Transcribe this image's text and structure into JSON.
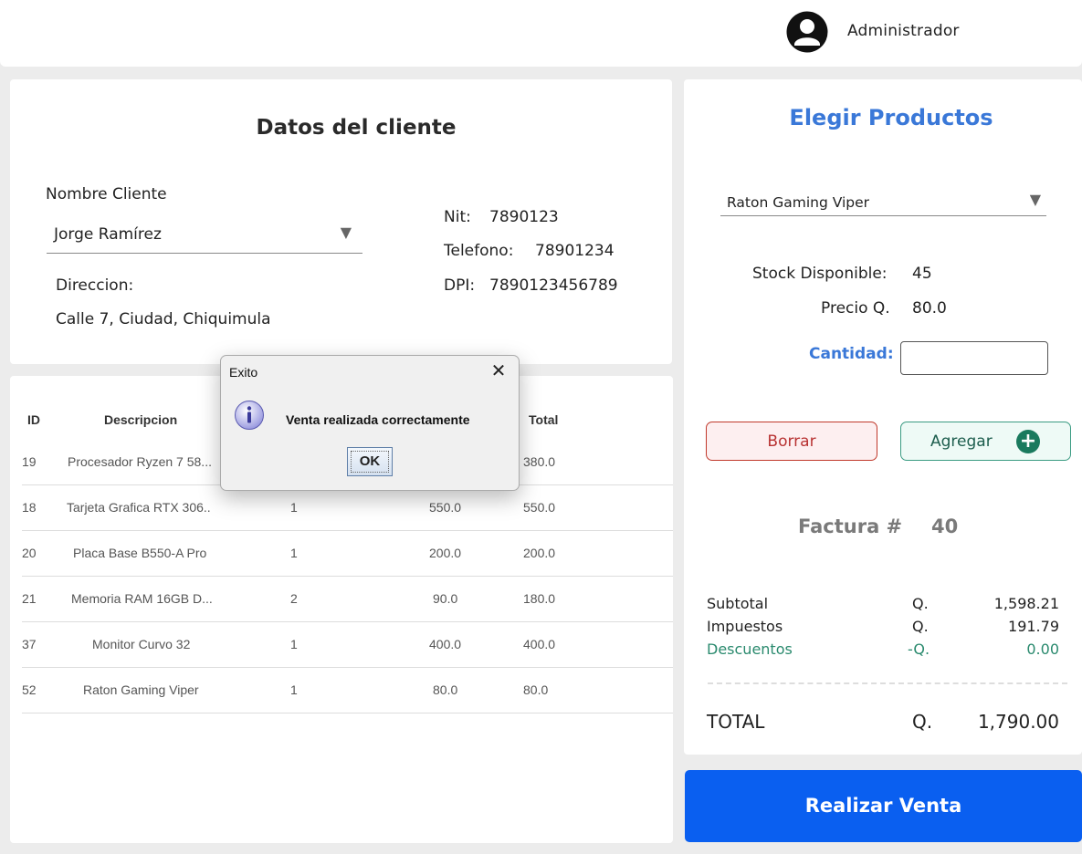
{
  "header": {
    "user_name": "Administrador",
    "avatar_icon": "user-circle-icon"
  },
  "client": {
    "title": "Datos del cliente",
    "name_label": "Nombre Cliente",
    "name_value": "Jorge Ramírez",
    "address_label": "Direccion:",
    "address_value": "Calle 7, Ciudad, Chiquimula",
    "nit_label": "Nit:",
    "nit_value": "7890123",
    "phone_label": "Telefono:",
    "phone_value": "78901234",
    "dpi_label": "DPI:",
    "dpi_value": "7890123456789"
  },
  "table": {
    "headers": {
      "id": "ID",
      "desc": "Descripcion",
      "total": "Total"
    },
    "rows": [
      {
        "id": "19",
        "desc": "Procesador Ryzen 7 58...",
        "qty": "",
        "price": "",
        "total": "380.0"
      },
      {
        "id": "18",
        "desc": "Tarjeta Grafica RTX 306..",
        "qty": "1",
        "price": "550.0",
        "total": "550.0"
      },
      {
        "id": "20",
        "desc": "Placa Base B550-A Pro",
        "qty": "1",
        "price": "200.0",
        "total": "200.0"
      },
      {
        "id": "21",
        "desc": "Memoria RAM 16GB D...",
        "qty": "2",
        "price": "90.0",
        "total": "180.0"
      },
      {
        "id": "37",
        "desc": "Monitor Curvo 32",
        "qty": "1",
        "price": "400.0",
        "total": "400.0"
      },
      {
        "id": "52",
        "desc": "Raton Gaming Viper",
        "qty": "1",
        "price": "80.0",
        "total": "80.0"
      }
    ]
  },
  "products": {
    "title": "Elegir Productos",
    "selected": "Raton Gaming Viper",
    "stock_label": "Stock Disponible:",
    "stock_value": "45",
    "price_label": "Precio Q.",
    "price_value": "80.0",
    "qty_label": "Cantidad:",
    "qty_value": "",
    "clear_button": "Borrar",
    "add_button": "Agregar"
  },
  "invoice": {
    "label": "Factura #",
    "number": "40",
    "subtotal_label": "Subtotal",
    "subtotal_currency": "Q.",
    "subtotal_value": "1,598.21",
    "tax_label": "Impuestos",
    "tax_currency": "Q.",
    "tax_value": "191.79",
    "discount_label": "Descuentos",
    "discount_currency": "-Q.",
    "discount_value": "0.00",
    "total_label": "TOTAL",
    "total_currency": "Q.",
    "total_value": "1,790.00"
  },
  "sell_button": "Realizar Venta",
  "dialog": {
    "title": "Exito",
    "message": "Venta realizada correctamente",
    "ok_label": "OK",
    "icon": "info-icon"
  },
  "colors": {
    "accent_blue": "#0a5ff0",
    "title_blue": "#3a78d8",
    "danger_red": "#b83232",
    "success_green": "#1a7a5e"
  }
}
